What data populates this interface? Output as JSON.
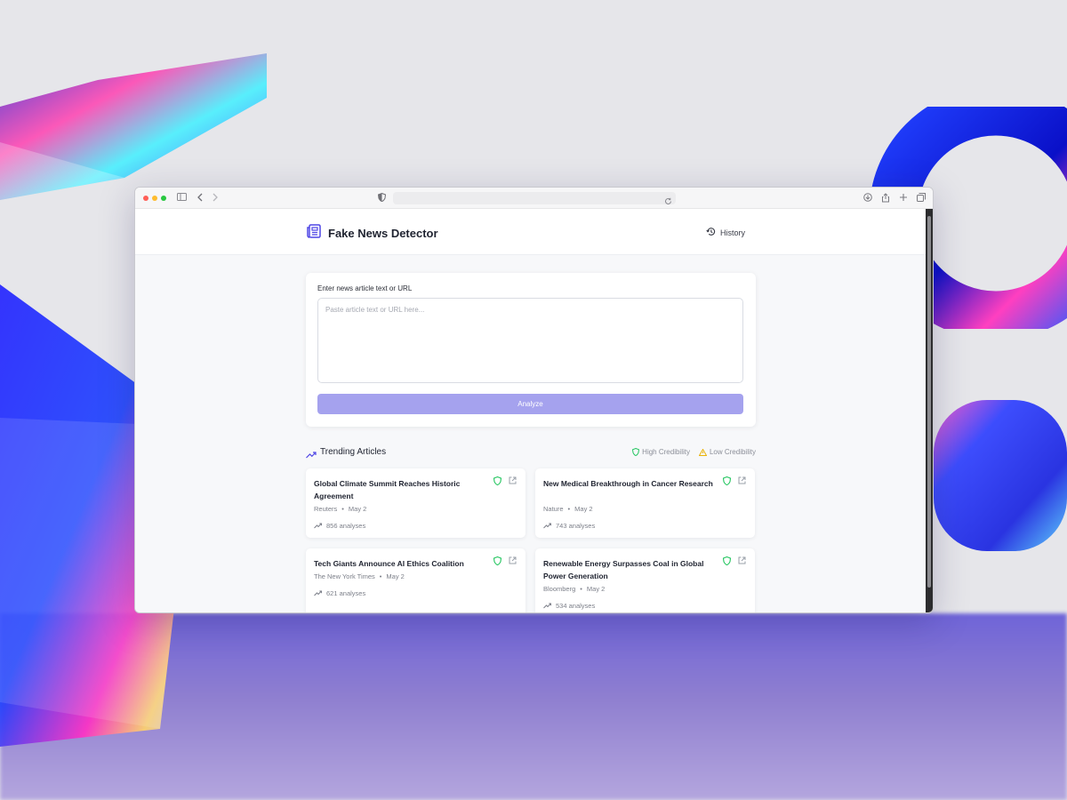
{
  "app": {
    "title": "Fake News Detector"
  },
  "header": {
    "history_label": "History"
  },
  "input": {
    "label": "Enter news article text or URL",
    "placeholder": "Paste article text or URL here...",
    "value": "",
    "analyze_label": "Analyze"
  },
  "trending": {
    "title": "Trending Articles",
    "legend_high": "High Credibility",
    "legend_low": "Low Credibility",
    "articles": [
      {
        "title": "Global Climate Summit Reaches Historic Agreement",
        "source": "Reuters",
        "date": "May 2",
        "analyses": "856 analyses",
        "credibility": "high"
      },
      {
        "title": "New Medical Breakthrough in Cancer Research",
        "source": "Nature",
        "date": "May 2",
        "analyses": "743 analyses",
        "credibility": "high"
      },
      {
        "title": "Tech Giants Announce AI Ethics Coalition",
        "source": "The New York Times",
        "date": "May 2",
        "analyses": "621 analyses",
        "credibility": "high"
      },
      {
        "title": "Renewable Energy Surpasses Coal in Global Power Generation",
        "source": "Bloomberg",
        "date": "May 2",
        "analyses": "534 analyses",
        "credibility": "high"
      }
    ]
  },
  "colors": {
    "accent": "#4f46e5",
    "button": "#a5a2ee",
    "high_credibility": "#22c55e",
    "low_credibility": "#eab308"
  },
  "icons": [
    "newspaper-icon",
    "history-icon",
    "trending-up-icon",
    "shield-icon",
    "alert-triangle-icon",
    "external-link-icon"
  ]
}
